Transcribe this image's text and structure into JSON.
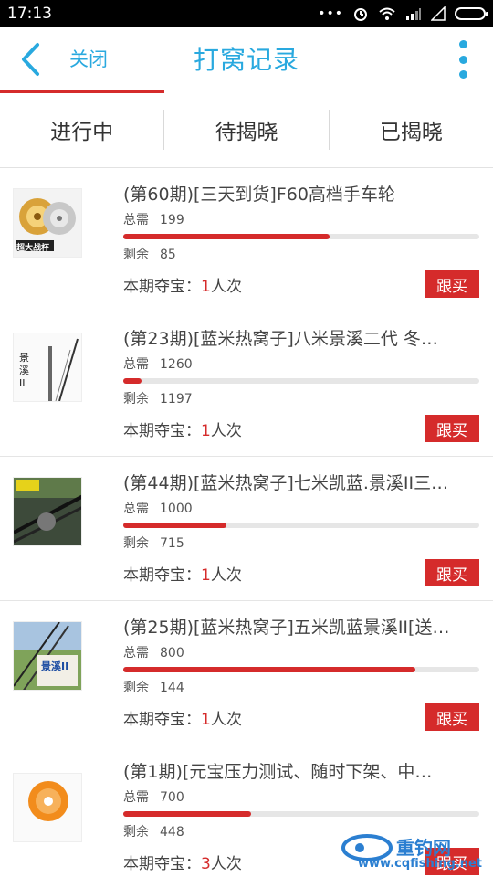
{
  "status_bar": {
    "time": "17:13",
    "dots": "•••"
  },
  "header": {
    "close_label": "关闭",
    "title": "打窝记录"
  },
  "tabs": [
    {
      "label": "进行中"
    },
    {
      "label": "待揭晓"
    },
    {
      "label": "已揭晓"
    }
  ],
  "items": [
    {
      "title": "(第60期)[三天到货]F60高档手车轮",
      "need_label": "总需",
      "need": "199",
      "progress": 0.58,
      "remain_label": "剩余",
      "remain": "85",
      "round_label": "本期夺宝：",
      "round_count": "1",
      "round_unit": "人次",
      "button": "跟买",
      "thumb_text": "超大战杯"
    },
    {
      "title": "(第23期)[蓝米热窝子]八米景溪二代 冬…",
      "need_label": "总需",
      "need": "1260",
      "progress": 0.05,
      "remain_label": "剩余",
      "remain": "1197",
      "round_label": "本期夺宝：",
      "round_count": "1",
      "round_unit": "人次",
      "button": "跟买",
      "thumb_text": "景溪 II"
    },
    {
      "title": "(第44期)[蓝米热窝子]七米凯蓝.景溪II三…",
      "need_label": "总需",
      "need": "1000",
      "progress": 0.29,
      "remain_label": "剩余",
      "remain": "715",
      "round_label": "本期夺宝：",
      "round_count": "1",
      "round_unit": "人次",
      "button": "跟买",
      "thumb_text": ""
    },
    {
      "title": "(第25期)[蓝米热窝子]五米凯蓝景溪II[送…",
      "need_label": "总需",
      "need": "800",
      "progress": 0.82,
      "remain_label": "剩余",
      "remain": "144",
      "round_label": "本期夺宝：",
      "round_count": "1",
      "round_unit": "人次",
      "button": "跟买",
      "thumb_text": "景溪II"
    },
    {
      "title": "(第1期)[元宝压力测试、随时下架、中…",
      "need_label": "总需",
      "need": "700",
      "progress": 0.36,
      "remain_label": "剩余",
      "remain": "448",
      "round_label": "本期夺宝：",
      "round_count": "3",
      "round_unit": "人次",
      "button": "跟买",
      "thumb_text": ""
    }
  ],
  "watermark": {
    "name": "重钓网",
    "url": "www.cqfishing.net"
  },
  "colors": {
    "accent_blue": "#29a9df",
    "accent_red": "#d52b2b"
  }
}
